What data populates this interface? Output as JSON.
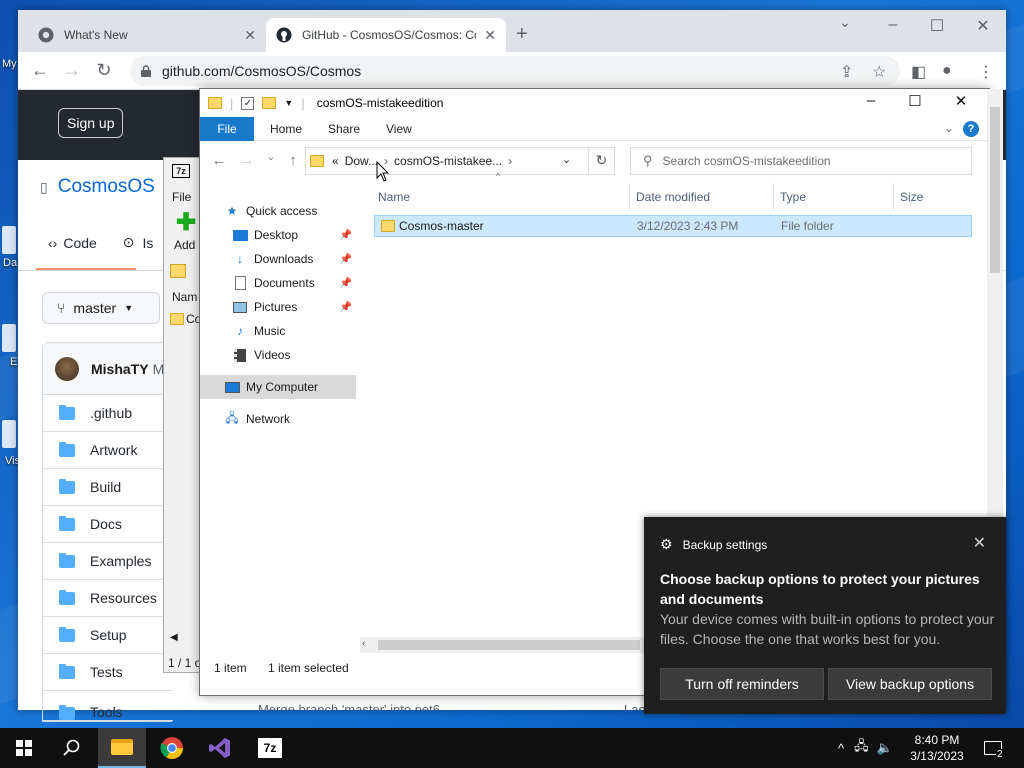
{
  "desktop": {
    "labels": [
      "My",
      "Da",
      "E",
      "Vis"
    ]
  },
  "chrome": {
    "tabs": [
      {
        "title": "What's New",
        "icon": "chrome-icon"
      },
      {
        "title": "GitHub - CosmosOS/Cosmos: Co",
        "icon": "github-icon"
      }
    ],
    "url": "github.com/CosmosOS/Cosmos",
    "colors": {
      "tabstrip": "#dee1e6"
    }
  },
  "github": {
    "signup": "Sign up",
    "repo": "CosmosOS",
    "tab_code": "Code",
    "tab_issues": "Is",
    "branch": "master",
    "commit_user": "MishaTY",
    "commit_more": "M",
    "files": [
      ".github",
      "Artwork",
      "Build",
      "Docs",
      "Examples",
      "Resources",
      "Setup",
      "Tests",
      "Tools"
    ],
    "merge_text": "Merge branch 'master' into net6",
    "merge_tail": "Las"
  },
  "sevenzip": {
    "file": "File",
    "add": "Add",
    "name_col": "Nam",
    "row": "Co",
    "status": "1 / 1 o"
  },
  "explorer": {
    "title": "cosmOS-mistakeedition",
    "ribbon": [
      "File",
      "Home",
      "Share",
      "View"
    ],
    "breadcrumb": {
      "prefix": "«",
      "part1": "Dow...",
      "part2": "cosmOS-mistakee..."
    },
    "search_placeholder": "Search cosmOS-mistakeedition",
    "nav": [
      {
        "label": "Quick access",
        "icon": "star-icon"
      },
      {
        "label": "Desktop",
        "icon": "desktop-icon",
        "pinned": true
      },
      {
        "label": "Downloads",
        "icon": "downloads-icon",
        "pinned": true
      },
      {
        "label": "Documents",
        "icon": "documents-icon",
        "pinned": true
      },
      {
        "label": "Pictures",
        "icon": "pictures-icon",
        "pinned": true
      },
      {
        "label": "Music",
        "icon": "music-icon"
      },
      {
        "label": "Videos",
        "icon": "videos-icon"
      },
      {
        "label": "My Computer",
        "icon": "computer-icon"
      },
      {
        "label": "Network",
        "icon": "network-icon"
      }
    ],
    "columns": [
      "Name",
      "Date modified",
      "Type",
      "Size"
    ],
    "rows": [
      {
        "name": "Cosmos-master",
        "date": "3/12/2023 2:43 PM",
        "type": "File folder",
        "size": ""
      }
    ],
    "status_items": "1 item",
    "status_selected": "1 item selected"
  },
  "toast": {
    "app": "Backup settings",
    "headline": "Choose backup options to protect your pictures and documents",
    "body": "Your device comes with built-in options to protect your files. Choose the one that works best for you.",
    "btn_off": "Turn off reminders",
    "btn_view": "View backup options"
  },
  "taskbar": {
    "time": "8:40 PM",
    "date": "3/13/2023",
    "notifications": "2",
    "sevenzip_label": "7z"
  }
}
